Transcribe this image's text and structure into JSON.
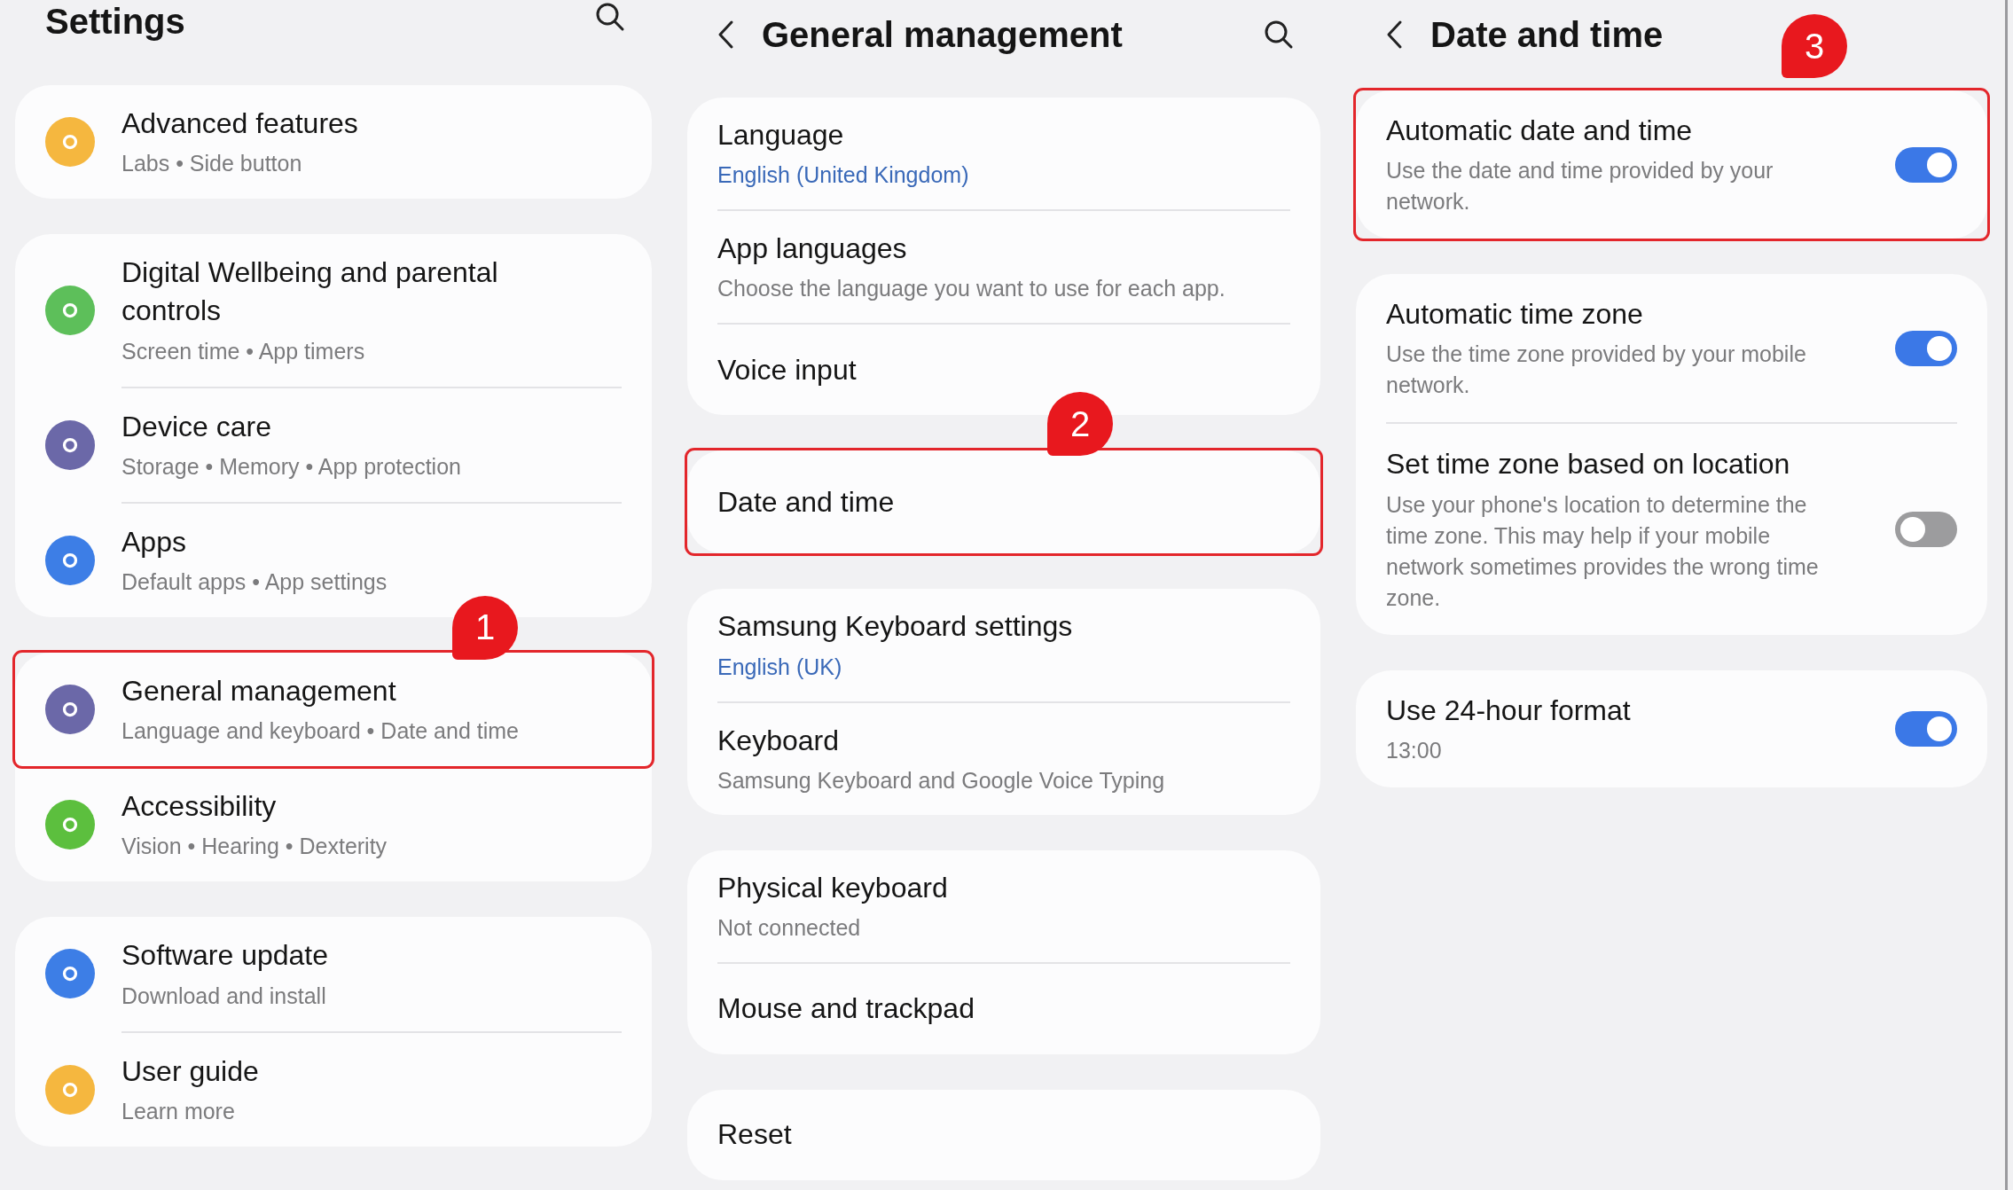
{
  "panels": [
    {
      "title": "Settings",
      "back": false,
      "search": true,
      "callout": "1",
      "groups": [
        [
          {
            "title": "Advanced features",
            "subtitle": "Labs • Side button",
            "color": "#f5b73f",
            "highlighted": false
          }
        ],
        [
          {
            "title": "Digital Wellbeing and parental controls",
            "subtitle": "Screen time • App timers",
            "color": "#5dbf5a",
            "highlighted": false
          },
          {
            "title": "Device care",
            "subtitle": "Storage • Memory • App protection",
            "color": "#6b68a8",
            "highlighted": false
          },
          {
            "title": "Apps",
            "subtitle": "Default apps • App settings",
            "color": "#3d7ee6",
            "highlighted": false
          }
        ],
        [
          {
            "title": "General management",
            "subtitle": "Language and keyboard • Date and time",
            "color": "#6b68a8",
            "highlighted": true
          },
          {
            "title": "Accessibility",
            "subtitle": "Vision • Hearing • Dexterity",
            "color": "#5cbf3e",
            "highlighted": false
          }
        ],
        [
          {
            "title": "Software update",
            "subtitle": "Download and install",
            "color": "#3d7ee6",
            "highlighted": false
          },
          {
            "title": "User guide",
            "subtitle": "Learn more",
            "color": "#f5b73f",
            "highlighted": false
          }
        ]
      ]
    },
    {
      "title": "General management",
      "back": true,
      "search": true,
      "callout": "2",
      "groups": [
        [
          {
            "title": "Language",
            "subtitle": "English (United Kingdom)",
            "accent": true,
            "highlighted": false
          },
          {
            "title": "App languages",
            "subtitle": "Choose the language you want to use for each app.",
            "accent": false,
            "highlighted": false
          },
          {
            "title": "Voice input",
            "highlighted": false
          }
        ],
        [
          {
            "title": "Date and time",
            "highlighted": true
          }
        ],
        [
          {
            "title": "Samsung Keyboard settings",
            "subtitle": "English (UK)",
            "accent": true,
            "highlighted": false
          },
          {
            "title": "Keyboard",
            "subtitle": "Samsung Keyboard and Google Voice Typing",
            "accent": false,
            "highlighted": false
          }
        ],
        [
          {
            "title": "Physical keyboard",
            "subtitle": "Not connected",
            "accent": false,
            "highlighted": false
          },
          {
            "title": "Mouse and trackpad",
            "highlighted": false
          }
        ],
        [
          {
            "title": "Reset",
            "highlighted": false
          }
        ]
      ]
    },
    {
      "title": "Date and time",
      "back": true,
      "search": false,
      "callout": "3",
      "groups": [
        [
          {
            "title": "Automatic date and time",
            "subtitle": "Use the date and time provided by your network.",
            "on": true,
            "highlighted": true
          }
        ],
        [
          {
            "title": "Automatic time zone",
            "subtitle": "Use the time zone provided by your mobile network.",
            "on": true,
            "highlighted": false
          },
          {
            "title": "Set time zone based on location",
            "subtitle": "Use your phone's location to determine the time zone. This may help if your mobile network sometimes provides the wrong time zone.",
            "on": false,
            "highlighted": false
          }
        ],
        [
          {
            "title": "Use 24-hour format",
            "subtitle": "13:00",
            "on": true,
            "highlighted": false
          }
        ]
      ]
    }
  ]
}
